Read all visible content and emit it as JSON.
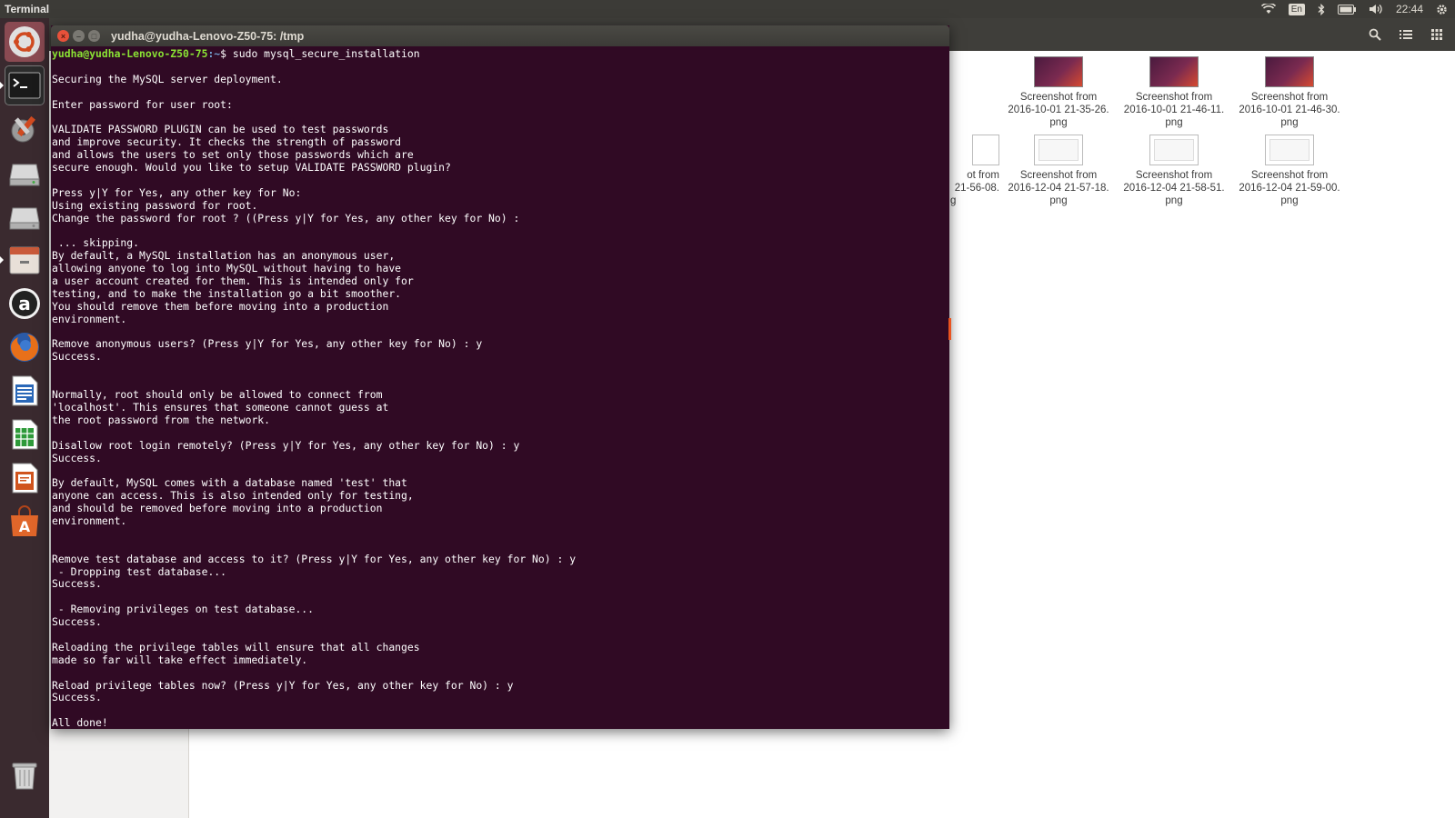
{
  "top_panel": {
    "app_title": "Terminal",
    "language": "En",
    "clock": "22:44"
  },
  "launcher": {
    "items": [
      {
        "name": "dash-icon",
        "label": "Search your computer"
      },
      {
        "name": "terminal-icon",
        "label": "Terminal"
      },
      {
        "name": "system-settings-icon",
        "label": "System Settings"
      },
      {
        "name": "drive-icon",
        "label": "Drive"
      },
      {
        "name": "drive-icon-2",
        "label": "Drive"
      },
      {
        "name": "files-icon",
        "label": "Files"
      },
      {
        "name": "amazon-icon",
        "label": "Amazon"
      },
      {
        "name": "firefox-icon",
        "label": "Firefox Web Browser"
      },
      {
        "name": "writer-icon",
        "label": "LibreOffice Writer"
      },
      {
        "name": "calc-icon",
        "label": "LibreOffice Calc"
      },
      {
        "name": "impress-icon",
        "label": "LibreOffice Impress"
      },
      {
        "name": "software-center-icon",
        "label": "Ubuntu Software Center"
      },
      {
        "name": "trash-icon",
        "label": "Trash"
      }
    ]
  },
  "file_manager": {
    "files": [
      {
        "line1": "ng",
        "line2": "",
        "line3": "",
        "thumb": "white-partial"
      },
      {
        "line1": "Screenshot from",
        "line2": "2016-10-01 21-35-26.",
        "line3": "png",
        "thumb": "purple"
      },
      {
        "line1": "Screenshot from",
        "line2": "2016-10-01 21-46-11.",
        "line3": "png",
        "thumb": "purple"
      },
      {
        "line1": "Screenshot from",
        "line2": "2016-10-01 21-46-30.",
        "line3": "png",
        "thumb": "purple"
      },
      {
        "line1": "ot from",
        "line2": "21-56-08.",
        "line3": "g",
        "thumb": "white-partial"
      },
      {
        "line1": "Screenshot from",
        "line2": "2016-12-04 21-57-18.",
        "line3": "png",
        "thumb": "white"
      },
      {
        "line1": "Screenshot from",
        "line2": "2016-12-04 21-58-51.",
        "line3": "png",
        "thumb": "white"
      },
      {
        "line1": "Screenshot from",
        "line2": "2016-12-04 21-59-00.",
        "line3": "png",
        "thumb": "white"
      }
    ]
  },
  "terminal": {
    "title": "yudha@yudha-Lenovo-Z50-75: /tmp",
    "prompt_user": "yudha@yudha-Lenovo-Z50-75",
    "prompt_path": ":~",
    "command": "$ sudo mysql_secure_installation",
    "lines": [
      "",
      "Securing the MySQL server deployment.",
      "",
      "Enter password for user root:",
      "",
      "VALIDATE PASSWORD PLUGIN can be used to test passwords",
      "and improve security. It checks the strength of password",
      "and allows the users to set only those passwords which are",
      "secure enough. Would you like to setup VALIDATE PASSWORD plugin?",
      "",
      "Press y|Y for Yes, any other key for No:",
      "Using existing password for root.",
      "Change the password for root ? ((Press y|Y for Yes, any other key for No) :",
      "",
      " ... skipping.",
      "By default, a MySQL installation has an anonymous user,",
      "allowing anyone to log into MySQL without having to have",
      "a user account created for them. This is intended only for",
      "testing, and to make the installation go a bit smoother.",
      "You should remove them before moving into a production",
      "environment.",
      "",
      "Remove anonymous users? (Press y|Y for Yes, any other key for No) : y",
      "Success.",
      "",
      "",
      "Normally, root should only be allowed to connect from",
      "'localhost'. This ensures that someone cannot guess at",
      "the root password from the network.",
      "",
      "Disallow root login remotely? (Press y|Y for Yes, any other key for No) : y",
      "Success.",
      "",
      "By default, MySQL comes with a database named 'test' that",
      "anyone can access. This is also intended only for testing,",
      "and should be removed before moving into a production",
      "environment.",
      "",
      "",
      "Remove test database and access to it? (Press y|Y for Yes, any other key for No) : y",
      " - Dropping test database...",
      "Success.",
      "",
      " - Removing privileges on test database...",
      "Success.",
      "",
      "Reloading the privilege tables will ensure that all changes",
      "made so far will take effect immediately.",
      "",
      "Reload privilege tables now? (Press y|Y for Yes, any other key for No) : y",
      "Success.",
      "",
      "All done!"
    ]
  }
}
